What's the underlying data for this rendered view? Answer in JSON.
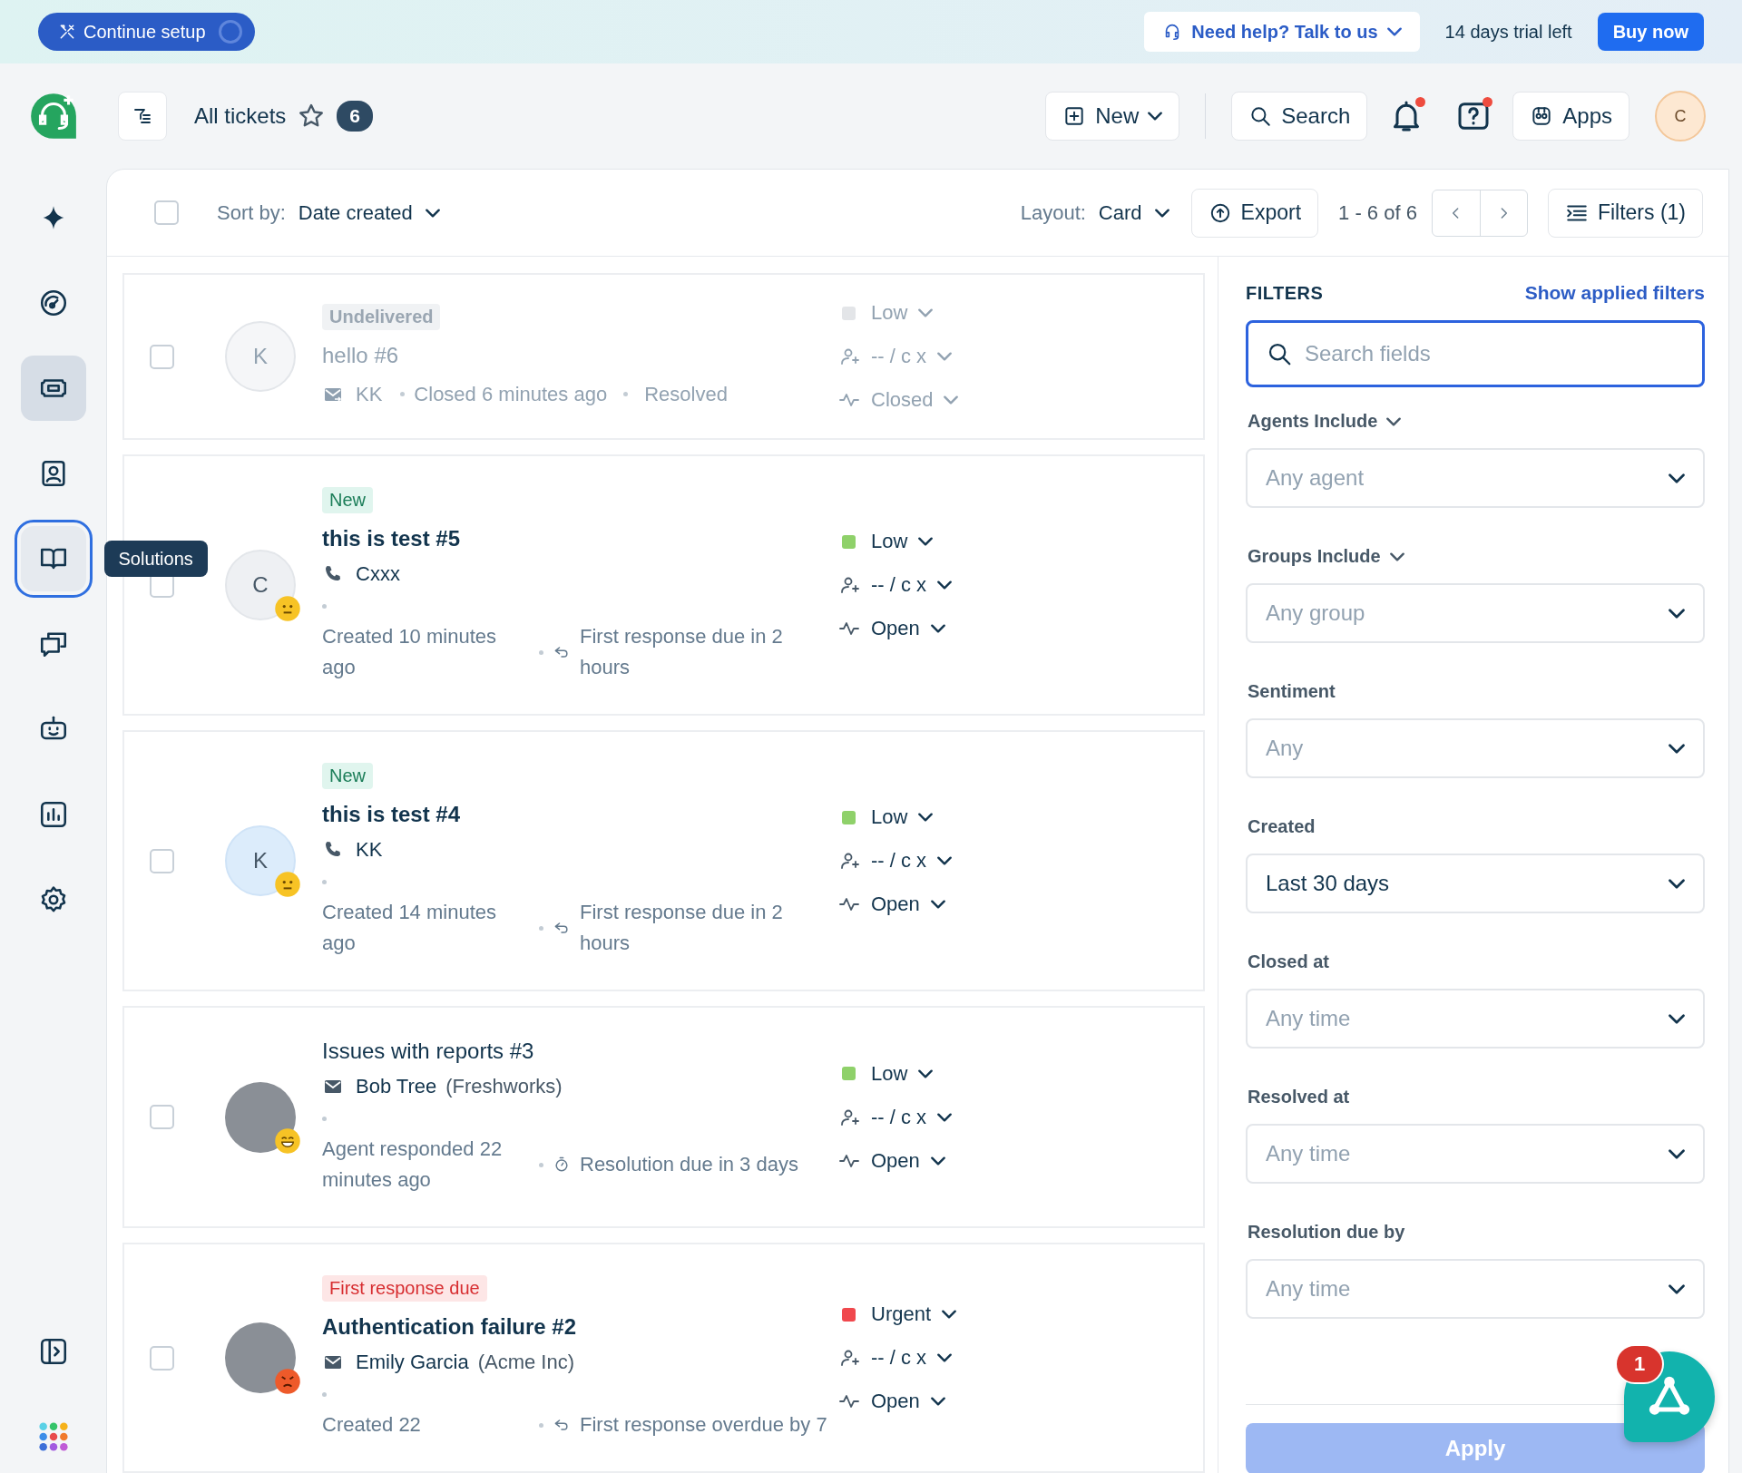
{
  "banner": {
    "setup_button": "Continue setup",
    "help_button": "Need help? Talk to us",
    "trial_text": "14 days trial left",
    "buy_button": "Buy now"
  },
  "header": {
    "title": "All tickets",
    "count": "6",
    "new_button": "New",
    "search_button": "Search",
    "notifications_unread": true,
    "help_unread": true,
    "apps_button": "Apps",
    "avatar": "C"
  },
  "sidebar": {
    "items": [
      {
        "selected": false,
        "focused": false
      },
      {
        "selected": false,
        "focused": false
      },
      {
        "selected": true,
        "focused": false
      },
      {
        "selected": false,
        "focused": false
      },
      {
        "selected": false,
        "focused": true
      },
      {
        "selected": false,
        "focused": false
      },
      {
        "selected": false,
        "focused": false
      },
      {
        "selected": false,
        "focused": false
      },
      {
        "selected": false,
        "focused": false
      }
    ],
    "tooltip": "Solutions"
  },
  "toolbar": {
    "select_all_checked": false,
    "sort_label": "Sort by:",
    "sort_value": "Date created",
    "layout_label": "Layout:",
    "layout_value": "Card",
    "export_button": "Export",
    "range": "1 - 6 of 6",
    "filters_button": "Filters (1)"
  },
  "tickets": [
    {
      "checked": false,
      "tag": {
        "text": "Undelivered",
        "kind": "muted"
      },
      "title": "hello #6",
      "unread": false,
      "closed": true,
      "avatar": {
        "kind": "initial",
        "text": "K"
      },
      "channel": {
        "kind": "email_out"
      },
      "contact": "KK",
      "created": "Closed 6 minutes ago",
      "due": {
        "text": "Resolved"
      },
      "priority": {
        "label": "Low",
        "color": "#e3e5e8"
      },
      "assignee": "-- / c x",
      "status": "Closed"
    },
    {
      "checked": false,
      "tag": {
        "text": "New",
        "kind": "new"
      },
      "title": "this is test #5",
      "unread": true,
      "closed": false,
      "avatar": {
        "kind": "initial",
        "text": "C"
      },
      "sentiment": {
        "kind": "neutral"
      },
      "channel": {
        "kind": "phone"
      },
      "contact": "Cxxx",
      "created": "Created 10 minutes ago",
      "due": {
        "kind": "reply",
        "text": "First response due in 2 hours"
      },
      "priority": {
        "label": "Low",
        "color": "#8fd16a"
      },
      "assignee": "-- / c x",
      "status": "Open"
    },
    {
      "checked": false,
      "tag": {
        "text": "New",
        "kind": "new"
      },
      "title": "this is test #4",
      "unread": true,
      "closed": false,
      "avatar": {
        "kind": "initial_highlighted",
        "text": "K"
      },
      "sentiment": {
        "kind": "neutral"
      },
      "channel": {
        "kind": "phone"
      },
      "contact": "KK",
      "created": "Created 14 minutes ago",
      "due": {
        "kind": "reply",
        "text": "First response due in 2 hours"
      },
      "priority": {
        "label": "Low",
        "color": "#8fd16a"
      },
      "assignee": "-- / c x",
      "status": "Open"
    },
    {
      "checked": false,
      "title": "Issues with reports #3",
      "unread": false,
      "closed": false,
      "avatar": {
        "kind": "photo"
      },
      "sentiment": {
        "kind": "grin"
      },
      "channel": {
        "kind": "email"
      },
      "contact": "Bob Tree",
      "company": "(Freshworks)",
      "created": "Agent responded 22 minutes ago",
      "due": {
        "kind": "timer",
        "text": "Resolution due in 3 days"
      },
      "priority": {
        "label": "Low",
        "color": "#8fd16a"
      },
      "assignee": "-- / c x",
      "status": "Open"
    },
    {
      "checked": false,
      "tag": {
        "text": "First response due",
        "kind": "danger"
      },
      "title": "Authentication failure #2",
      "unread": true,
      "closed": false,
      "avatar": {
        "kind": "photo"
      },
      "sentiment": {
        "kind": "angry"
      },
      "channel": {
        "kind": "email"
      },
      "contact": "Emily Garcia",
      "company": "(Acme Inc)",
      "created": "Created 22",
      "due": {
        "kind": "reply",
        "text": "First response overdue by 7"
      },
      "priority": {
        "label": "Urgent",
        "color": "#f0484d"
      },
      "assignee": "-- / c x",
      "status": "Open"
    }
  ],
  "filters": {
    "title": "FILTERS",
    "link": "Show applied filters",
    "search_placeholder": "Search fields",
    "fields": [
      {
        "label": "Agents Include",
        "kind": "dropdown_label",
        "placeholder": "Any agent"
      },
      {
        "label": "Groups Include",
        "kind": "dropdown_label",
        "placeholder": "Any group"
      },
      {
        "label": "Sentiment",
        "kind": "plain",
        "placeholder": "Any"
      },
      {
        "label": "Created",
        "kind": "plain",
        "value": "Last 30 days"
      },
      {
        "label": "Closed at",
        "kind": "plain",
        "placeholder": "Any time"
      },
      {
        "label": "Resolved at",
        "kind": "plain",
        "placeholder": "Any time"
      },
      {
        "label": "Resolution due by",
        "kind": "plain",
        "placeholder": "Any time"
      }
    ],
    "apply_button": "Apply",
    "apply_disabled": true
  },
  "assistant": {
    "badge": "1"
  }
}
